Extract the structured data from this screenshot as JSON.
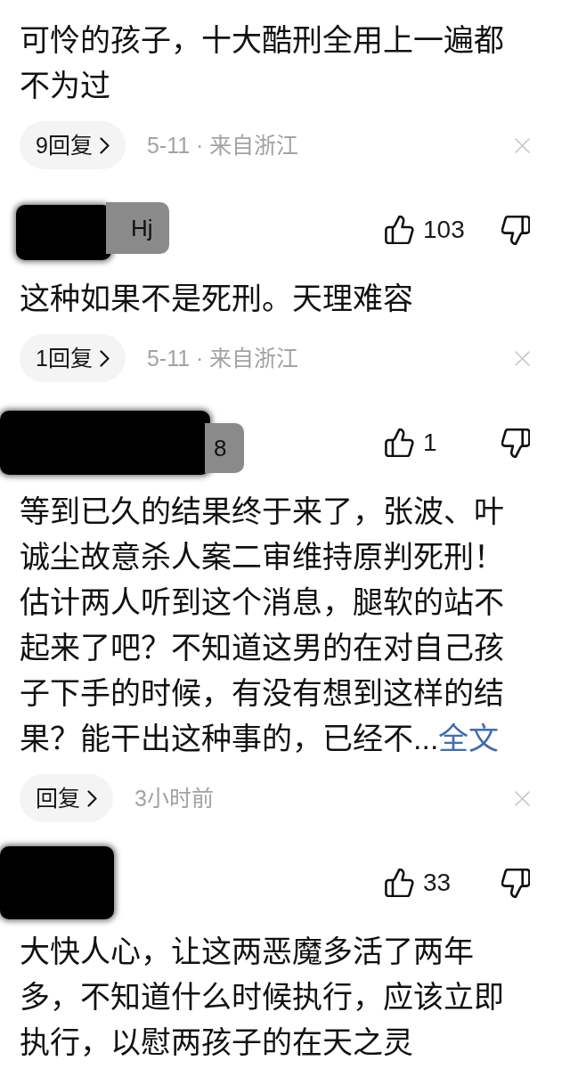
{
  "comments": [
    {
      "text": "可怜的孩子，十大酷刑全用上一遍都不为过",
      "reply_button": "9回复",
      "meta": "5-11 · 来自浙江"
    },
    {
      "author": {
        "name_redacted": true,
        "username": "Hj"
      },
      "likes": "103",
      "text": "这种如果不是死刑。天理难容",
      "reply_button": "1回复",
      "meta": "5-11 · 来自浙江"
    },
    {
      "author": {
        "name_redacted": true,
        "username": "8"
      },
      "likes": "1",
      "text": "等到已久的结果终于来了，张波、叶诚尘故意杀人案二审维持原判死刑！估计两人听到这个消息，腿软的站不起来了吧？不知道这男的在对自己孩子下手的时候，有没有想到这样的结果？能干出这种事的，已经不...",
      "more_link": "全文",
      "reply_button": "回复",
      "meta": "3小时前"
    },
    {
      "author": {
        "name_redacted": true
      },
      "likes": "33",
      "text": "大快人心，让这两恶魔多活了两年多，不知道什么时候执行，应该立即执行，以慰两孩子的在天之灵"
    }
  ]
}
